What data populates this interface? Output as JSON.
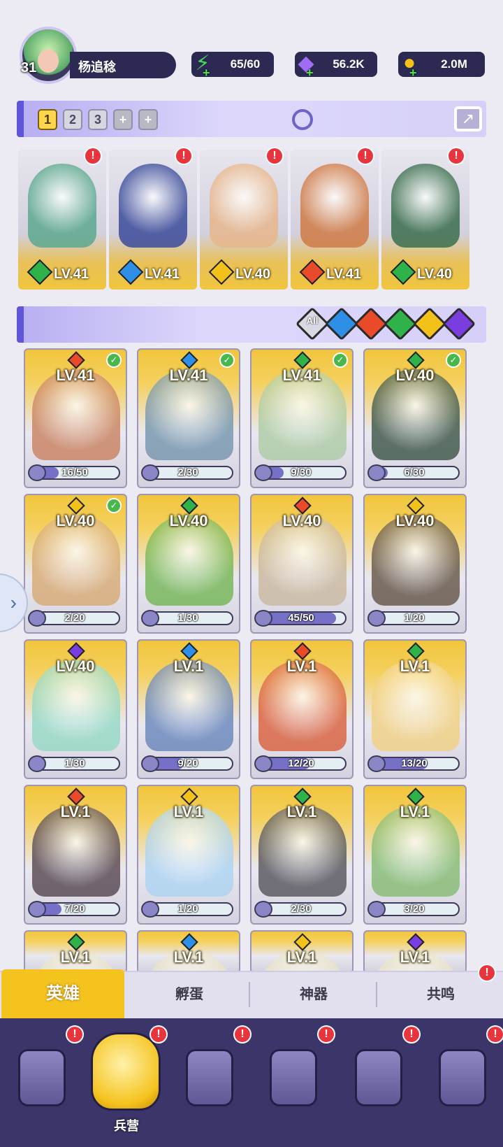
{
  "player": {
    "level": "31",
    "name": "杨追稔"
  },
  "resources": {
    "energy": "65/60",
    "gems": "56.2K",
    "gold": "2.0M"
  },
  "team": {
    "tabs": [
      "1",
      "2",
      "3",
      "+",
      "+"
    ],
    "active_tab": "1",
    "heroes": [
      {
        "level": "LV.41",
        "element": "leaf",
        "element_color": "#2fb24a",
        "art_color": "#5ca88e",
        "alert": "!"
      },
      {
        "level": "LV.41",
        "element": "water",
        "element_color": "#2d8fe6",
        "art_color": "#3b4b9a",
        "alert": "!"
      },
      {
        "level": "LV.40",
        "element": "light",
        "element_color": "#f2c21a",
        "art_color": "#e7b68c",
        "alert": "!"
      },
      {
        "level": "LV.41",
        "element": "fire",
        "element_color": "#e84a2a",
        "art_color": "#d07a45",
        "alert": "!"
      },
      {
        "level": "LV.40",
        "element": "leaf",
        "element_color": "#2fb24a",
        "art_color": "#3a6e4c",
        "alert": "!"
      }
    ]
  },
  "filters": [
    {
      "label": "All",
      "icon": "all-icon",
      "color": "#d9d9e4"
    },
    {
      "label": "",
      "icon": "water-icon",
      "color": "#2d8fe6"
    },
    {
      "label": "",
      "icon": "fire-icon",
      "color": "#e84a2a"
    },
    {
      "label": "",
      "icon": "leaf-icon",
      "color": "#2fb24a"
    },
    {
      "label": "",
      "icon": "light-icon",
      "color": "#f2c21a"
    },
    {
      "label": "",
      "icon": "dark-icon",
      "color": "#7a3de0"
    }
  ],
  "roster": [
    {
      "level": "LV.41",
      "element": "fire",
      "element_color": "#e84a2a",
      "art_color": "#c77a55",
      "count": "16/50",
      "progress": 0.32,
      "checked": true
    },
    {
      "level": "LV.41",
      "element": "water",
      "element_color": "#2d8fe6",
      "art_color": "#6d8fa8",
      "count": "2/30",
      "progress": 0.07,
      "checked": true
    },
    {
      "level": "LV.41",
      "element": "leaf",
      "element_color": "#2fb24a",
      "art_color": "#a9c9a0",
      "count": "9/30",
      "progress": 0.3,
      "checked": true
    },
    {
      "level": "LV.40",
      "element": "leaf",
      "element_color": "#2fb24a",
      "art_color": "#2f4a3a",
      "count": "6/30",
      "progress": 0.2,
      "checked": true
    },
    {
      "level": "LV.40",
      "element": "light",
      "element_color": "#f2c21a",
      "art_color": "#d6a56a",
      "count": "2/20",
      "progress": 0.1,
      "checked": true
    },
    {
      "level": "LV.40",
      "element": "leaf",
      "element_color": "#2fb24a",
      "art_color": "#6bb24a",
      "count": "1/30",
      "progress": 0.03,
      "checked": false
    },
    {
      "level": "LV.40",
      "element": "fire",
      "element_color": "#e84a2a",
      "art_color": "#c8b59a",
      "count": "45/50",
      "progress": 0.9,
      "checked": false
    },
    {
      "level": "LV.40",
      "element": "light",
      "element_color": "#f2c21a",
      "art_color": "#5a4a3a",
      "count": "1/20",
      "progress": 0.05,
      "checked": false
    },
    {
      "level": "LV.40",
      "element": "dark",
      "element_color": "#7a3de0",
      "art_color": "#8fd8c2",
      "count": "1/30",
      "progress": 0.03,
      "checked": false
    },
    {
      "level": "LV.1",
      "element": "water",
      "element_color": "#2d8fe6",
      "art_color": "#5f7fb8",
      "count": "9/20",
      "progress": 0.45,
      "checked": false
    },
    {
      "level": "LV.1",
      "element": "fire",
      "element_color": "#e84a2a",
      "art_color": "#d8552f",
      "count": "12/20",
      "progress": 0.6,
      "checked": false
    },
    {
      "level": "LV.1",
      "element": "leaf",
      "element_color": "#2fb24a",
      "art_color": "#f2cf7a",
      "count": "13/20",
      "progress": 0.65,
      "checked": false
    },
    {
      "level": "LV.1",
      "element": "fire",
      "element_color": "#e84a2a",
      "art_color": "#4a3a44",
      "count": "7/20",
      "progress": 0.35,
      "checked": false
    },
    {
      "level": "LV.1",
      "element": "light",
      "element_color": "#f2c21a",
      "art_color": "#a8d2f2",
      "count": "1/20",
      "progress": 0.05,
      "checked": false
    },
    {
      "level": "LV.1",
      "element": "leaf",
      "element_color": "#2fb24a",
      "art_color": "#4a4a52",
      "count": "2/30",
      "progress": 0.07,
      "checked": false
    },
    {
      "level": "LV.1",
      "element": "leaf",
      "element_color": "#2fb24a",
      "art_color": "#7db86a",
      "count": "3/20",
      "progress": 0.15,
      "checked": false
    },
    {
      "level": "LV.1",
      "element": "leaf",
      "element_color": "#2fb24a",
      "art_color": "#e9e2c0",
      "count": "",
      "progress": 0,
      "checked": false
    },
    {
      "level": "LV.1",
      "element": "water",
      "element_color": "#2d8fe6",
      "art_color": "#e9e2c0",
      "count": "",
      "progress": 0,
      "checked": false
    },
    {
      "level": "LV.1",
      "element": "light",
      "element_color": "#f2c21a",
      "art_color": "#e9e2c0",
      "count": "",
      "progress": 0,
      "checked": false
    },
    {
      "level": "LV.1",
      "element": "dark",
      "element_color": "#7a3de0",
      "art_color": "#e9e2c0",
      "count": "",
      "progress": 0,
      "checked": false
    }
  ],
  "subtabs": [
    {
      "label": "英雄",
      "active": true,
      "alert": ""
    },
    {
      "label": "孵蛋",
      "active": false,
      "alert": ""
    },
    {
      "label": "神器",
      "active": false,
      "alert": ""
    },
    {
      "label": "共鸣",
      "active": false,
      "alert": "!"
    }
  ],
  "bottom_nav": [
    {
      "label": "",
      "icon": "cards-icon",
      "alert": "!",
      "active": false
    },
    {
      "label": "兵营",
      "icon": "barracks-icon",
      "alert": "!",
      "active": true
    },
    {
      "label": "",
      "icon": "map-icon",
      "alert": "!",
      "active": false
    },
    {
      "label": "",
      "icon": "castle-icon",
      "alert": "!",
      "active": false
    },
    {
      "label": "",
      "icon": "guild-icon",
      "alert": "!",
      "active": false
    },
    {
      "label": "",
      "icon": "banner-icon",
      "alert": "!",
      "active": false
    }
  ],
  "colors": {
    "accent": "#5e55d8",
    "gold_tab": "#f5c31e",
    "nav_bg": "#3b3569",
    "alert": "#e8343d"
  }
}
